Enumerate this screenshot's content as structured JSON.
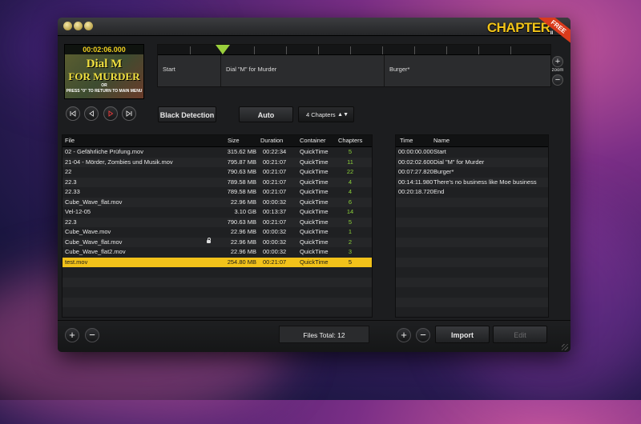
{
  "app": {
    "logo_text": "CHAPTER",
    "logo_sub": "ıı",
    "ribbon_text": "FREE",
    "accent_yellow": "#f2c21a",
    "chapter_green": "#8cd23a"
  },
  "preview": {
    "timecode": "00:02:06.000",
    "poster_line1": "Dial M",
    "poster_line2": "FOR MURDER",
    "poster_line3": "OR",
    "poster_line4": "PRESS \"0\" TO RETURN TO MAIN MENU"
  },
  "timeline": {
    "segments": [
      "Start",
      "Dial \"M\" for Murder",
      "Burger*"
    ],
    "zoom_label": "zoom",
    "zoom_in": "+",
    "zoom_out": "−"
  },
  "controls": {
    "black_detection": "Black Detection",
    "auto": "Auto",
    "chapters_select": "4 Chapters",
    "select_arrows": "▲▼",
    "skip_back_icon": "skip-back-icon",
    "step_back_icon": "step-back-icon",
    "play_icon": "play-icon",
    "skip_forward_icon": "skip-forward-icon"
  },
  "files": {
    "headers": [
      "File",
      "Size",
      "Duration",
      "Container",
      "Chapters"
    ],
    "rows": [
      {
        "file": "02 - Gefährliche Prüfung.mov",
        "size": "315.62 MB",
        "duration": "00:22:34",
        "container": "QuickTime",
        "chapters": "5",
        "locked": false,
        "selected": false
      },
      {
        "file": "21-04 - Mörder, Zombies und Musik.mov",
        "size": "795.87 MB",
        "duration": "00:21:07",
        "container": "QuickTime",
        "chapters": "11",
        "locked": false,
        "selected": false
      },
      {
        "file": "22",
        "size": "790.63 MB",
        "duration": "00:21:07",
        "container": "QuickTime",
        "chapters": "22",
        "locked": false,
        "selected": false
      },
      {
        "file": "22.3",
        "size": "789.58 MB",
        "duration": "00:21:07",
        "container": "QuickTime",
        "chapters": "4",
        "locked": false,
        "selected": false
      },
      {
        "file": "22.33",
        "size": "789.58 MB",
        "duration": "00:21:07",
        "container": "QuickTime",
        "chapters": "4",
        "locked": false,
        "selected": false
      },
      {
        "file": "Cube_Wave_flat.mov",
        "size": "22.96 MB",
        "duration": "00:00:32",
        "container": "QuickTime",
        "chapters": "6",
        "locked": false,
        "selected": false
      },
      {
        "file": "Vel-12-05",
        "size": "3.10 GB",
        "duration": "00:13:37",
        "container": "QuickTime",
        "chapters": "14",
        "locked": false,
        "selected": false
      },
      {
        "file": "22.3",
        "size": "790.63 MB",
        "duration": "00:21:07",
        "container": "QuickTime",
        "chapters": "5",
        "locked": false,
        "selected": false
      },
      {
        "file": "Cube_Wave.mov",
        "size": "22.96 MB",
        "duration": "00:00:32",
        "container": "QuickTime",
        "chapters": "1",
        "locked": false,
        "selected": false
      },
      {
        "file": "Cube_Wave_flat.mov",
        "size": "22.96 MB",
        "duration": "00:00:32",
        "container": "QuickTime",
        "chapters": "2",
        "locked": true,
        "selected": false
      },
      {
        "file": "Cube_Wave_flat2.mov",
        "size": "22.96 MB",
        "duration": "00:00:32",
        "container": "QuickTime",
        "chapters": "3",
        "locked": false,
        "selected": false
      },
      {
        "file": "test.mov",
        "size": "254.80 MB",
        "duration": "00:21:07",
        "container": "QuickTime",
        "chapters": "5",
        "locked": false,
        "selected": true
      }
    ],
    "total_label": "Files Total: 12",
    "add": "+",
    "remove": "−"
  },
  "chapters": {
    "headers": [
      "Time",
      "Name"
    ],
    "rows": [
      {
        "time": "00:00:00.000",
        "name": "Start"
      },
      {
        "time": "00:02:02.600",
        "name": "Dial \"M\" for Murder"
      },
      {
        "time": "00:07:27.820",
        "name": "Burger*"
      },
      {
        "time": "00:14:11.980",
        "name": "There's no business like Moe business"
      },
      {
        "time": "00:20:18.720",
        "name": "End"
      }
    ],
    "add": "+",
    "remove": "−",
    "import": "Import",
    "edit": "Edit"
  }
}
